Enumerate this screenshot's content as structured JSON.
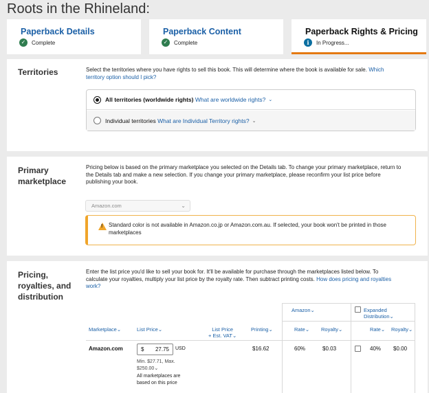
{
  "book_title": "Roots in the Rhineland:",
  "tabs": [
    {
      "label": "Paperback Details",
      "status": "Complete"
    },
    {
      "label": "Paperback Content",
      "status": "Complete"
    },
    {
      "label": "Paperback Rights & Pricing",
      "status": "In Progress..."
    }
  ],
  "territories": {
    "title": "Territories",
    "description": "Select the territories where you have rights to sell this book. This will determine where the book is available for sale.",
    "help_link_1": "Which",
    "help_link_2": "territory option should I pick?",
    "options": [
      {
        "label": "All territories (worldwide rights)",
        "link": "What are worldwide rights?",
        "selected": true
      },
      {
        "label": "Individual territories",
        "link": "What are Individual Territory rights?",
        "selected": false
      }
    ]
  },
  "primary_marketplace": {
    "title_line1": "Primary",
    "title_line2": "marketplace",
    "description_lines": [
      "Pricing below is based on the primary marketplace you selected on the Details tab. To change your primary marketplace, return to",
      "the Details tab and make a new selection. If you change your primary marketplace, please reconfirm your list price before",
      "publishing your book."
    ],
    "selected_value": "Amazon.com",
    "alert_lines": [
      "Standard color is not available in Amazon.co.jp or Amazon.com.au. If selected, your book won't be printed in those",
      "marketplaces"
    ]
  },
  "pricing": {
    "title_line1": "Pricing,",
    "title_line2": "royalties, and",
    "title_line3": "distribution",
    "description_line1": "Enter the list price you'd like to sell your book for. It'll be available for purchase through the marketplaces listed below. To",
    "description_line2": "calculate your royalties, multiply your list price by the royalty rate. Then subtract printing costs.",
    "help_link_1": "How does pricing and royalties",
    "help_link_2": "work?",
    "group_amazon": "Amazon",
    "group_expanded_line1": "Expanded",
    "group_expanded_line2": "Distribution",
    "headers": {
      "marketplace": "Marketplace",
      "list_price": "List Price",
      "list_price_vat_line1": "List Price",
      "list_price_vat_line2": "+ Est. VAT",
      "printing": "Printing",
      "rate": "Rate",
      "royalty": "Royalty",
      "exp_rate": "Rate",
      "exp_royalty": "Royalty"
    },
    "row": {
      "marketplace": "Amazon.com",
      "currency_symbol": "$",
      "price_value": "27.75",
      "currency": "USD",
      "min_max_line1": "Min. $27.71, Max.",
      "min_max_line2": "$250.00",
      "note_line1": "All marketplaces are",
      "note_line2": "based on this price",
      "printing": "$16.62",
      "rate": "60%",
      "royalty": "$0.03",
      "exp_rate": "40%",
      "exp_royalty": "$0.00"
    }
  }
}
